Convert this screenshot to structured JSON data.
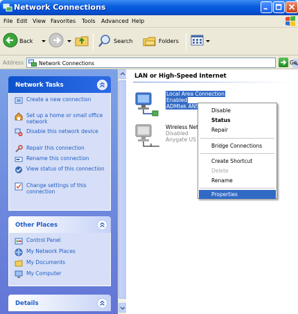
{
  "window": {
    "title": "Network Connections"
  },
  "menubar": {
    "items": [
      "File",
      "Edit",
      "View",
      "Favorites",
      "Tools",
      "Advanced",
      "Help"
    ]
  },
  "toolbar": {
    "back": "Back",
    "search": "Search",
    "folders": "Folders"
  },
  "address": {
    "label": "Address",
    "value": "Network Connections",
    "go": "Go"
  },
  "left_pane": {
    "network_tasks": {
      "title": "Network Tasks",
      "items": [
        "Create a new connection",
        "Set up a home or small office network",
        "Disable this network device",
        "Repair this connection",
        "Rename this connection",
        "View status of this connection",
        "Change settings of this connection"
      ]
    },
    "other_places": {
      "title": "Other Places",
      "items": [
        "Control Panel",
        "My Network Places",
        "My Documents",
        "My Computer"
      ]
    },
    "details": {
      "title": "Details"
    }
  },
  "main": {
    "group_title": "LAN or High-Speed Internet",
    "connections": [
      {
        "name": "Local Area Connection",
        "status": "Enabled",
        "device": "ADMtek ANS"
      },
      {
        "name": "Wireless Net",
        "status": "Disabled",
        "device": "Anygate US"
      }
    ]
  },
  "context_menu": {
    "items": [
      "Disable",
      "Status",
      "Repair",
      "Bridge Connections",
      "Create Shortcut",
      "Delete",
      "Rename",
      "Properties"
    ]
  },
  "colors": {
    "selection": "#316ac5",
    "task_link": "#215dc6",
    "pane_bg": "#7ba2e7"
  }
}
